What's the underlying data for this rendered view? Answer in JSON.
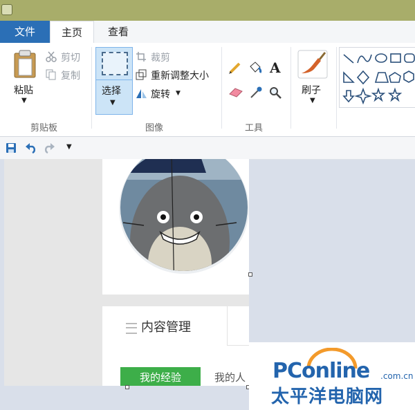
{
  "tabs": {
    "file": "文件",
    "home": "主页",
    "view": "查看"
  },
  "clipboard": {
    "paste": "粘贴",
    "cut": "剪切",
    "copy": "复制",
    "label": "剪贴板"
  },
  "image": {
    "select": "选择",
    "crop": "裁剪",
    "resize": "重新调整大小",
    "rotate": "旋转",
    "label": "图像"
  },
  "tools": {
    "label": "工具",
    "text_tool": "A"
  },
  "brushes": {
    "label": "刷子"
  },
  "canvas": {
    "section_title": "内容管理",
    "tab_active": "我的经验",
    "tab_inactive": "我的人"
  },
  "watermark": {
    "brand": "PConline",
    "domain": ".com.cn",
    "cn_name": "太平洋电脑网"
  },
  "colors": {
    "file_tab": "#2b6fb6",
    "titlebar": "#a8ad6a",
    "green_button": "#3dae49",
    "brand_blue": "#2364ad",
    "brand_orange": "#f39a2b"
  }
}
